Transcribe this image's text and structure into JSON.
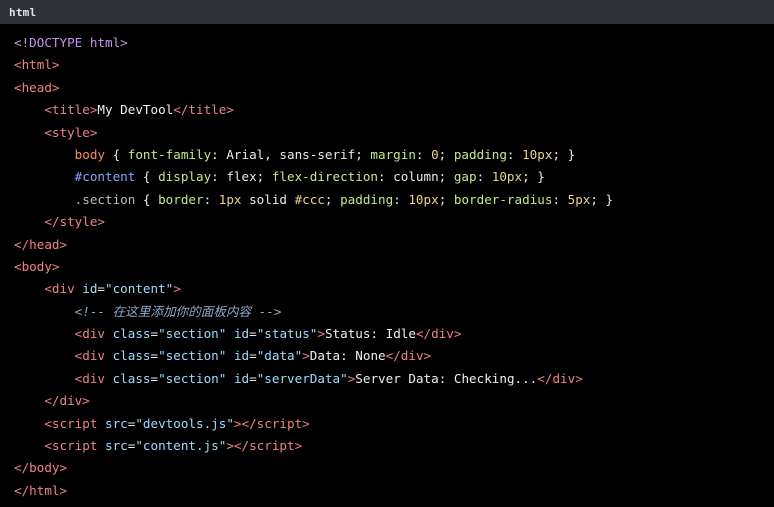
{
  "header": {
    "language": "html"
  },
  "colors": {
    "background": "#000000",
    "header_bg": "#2f3139",
    "tag": "#ee8383",
    "attr": "#9cdcfe",
    "text": "#f0f0f0",
    "doctype": "#c792ea",
    "comment": "#8faac5"
  },
  "code_lines": [
    [
      {
        "t": "<!DOCTYPE ",
        "c": "tok-doctype"
      },
      {
        "t": "html",
        "c": "tok-doctype"
      },
      {
        "t": ">",
        "c": "tok-doctype"
      }
    ],
    [
      {
        "t": "<html>",
        "c": "tok-tag"
      }
    ],
    [
      {
        "t": "<head>",
        "c": "tok-tag"
      }
    ],
    [
      {
        "t": "    <title>",
        "c": "tok-tag"
      },
      {
        "t": "My DevTool",
        "c": "tok-text"
      },
      {
        "t": "</title>",
        "c": "tok-tag"
      }
    ],
    [
      {
        "t": "    <style>",
        "c": "tok-tag"
      }
    ],
    [
      {
        "t": "        body",
        "c": "tok-sel"
      },
      {
        "t": " { ",
        "c": "tok-punc"
      },
      {
        "t": "font-family",
        "c": "tok-prop"
      },
      {
        "t": ": ",
        "c": "tok-punc"
      },
      {
        "t": "Arial, sans-serif",
        "c": "tok-punc"
      },
      {
        "t": "; ",
        "c": "tok-punc"
      },
      {
        "t": "margin",
        "c": "tok-prop"
      },
      {
        "t": ": ",
        "c": "tok-punc"
      },
      {
        "t": "0",
        "c": "tok-val"
      },
      {
        "t": "; ",
        "c": "tok-punc"
      },
      {
        "t": "padding",
        "c": "tok-prop"
      },
      {
        "t": ": ",
        "c": "tok-punc"
      },
      {
        "t": "10px",
        "c": "tok-val"
      },
      {
        "t": "; }",
        "c": "tok-punc"
      }
    ],
    [
      {
        "t": "        #content",
        "c": "tok-selid"
      },
      {
        "t": " { ",
        "c": "tok-punc"
      },
      {
        "t": "display",
        "c": "tok-prop"
      },
      {
        "t": ": ",
        "c": "tok-punc"
      },
      {
        "t": "flex",
        "c": "tok-punc"
      },
      {
        "t": "; ",
        "c": "tok-punc"
      },
      {
        "t": "flex-direction",
        "c": "tok-prop"
      },
      {
        "t": ": ",
        "c": "tok-punc"
      },
      {
        "t": "column",
        "c": "tok-punc"
      },
      {
        "t": "; ",
        "c": "tok-punc"
      },
      {
        "t": "gap",
        "c": "tok-prop"
      },
      {
        "t": ": ",
        "c": "tok-punc"
      },
      {
        "t": "10px",
        "c": "tok-val"
      },
      {
        "t": "; }",
        "c": "tok-punc"
      }
    ],
    [
      {
        "t": "        .section",
        "c": "tok-selclass"
      },
      {
        "t": " { ",
        "c": "tok-punc"
      },
      {
        "t": "border",
        "c": "tok-prop"
      },
      {
        "t": ": ",
        "c": "tok-punc"
      },
      {
        "t": "1px",
        "c": "tok-val"
      },
      {
        "t": " solid ",
        "c": "tok-punc"
      },
      {
        "t": "#ccc",
        "c": "tok-val"
      },
      {
        "t": "; ",
        "c": "tok-punc"
      },
      {
        "t": "padding",
        "c": "tok-prop"
      },
      {
        "t": ": ",
        "c": "tok-punc"
      },
      {
        "t": "10px",
        "c": "tok-val"
      },
      {
        "t": "; ",
        "c": "tok-punc"
      },
      {
        "t": "border-radius",
        "c": "tok-prop"
      },
      {
        "t": ": ",
        "c": "tok-punc"
      },
      {
        "t": "5px",
        "c": "tok-val"
      },
      {
        "t": "; }",
        "c": "tok-punc"
      }
    ],
    [
      {
        "t": "    </style>",
        "c": "tok-tag"
      }
    ],
    [
      {
        "t": "</head>",
        "c": "tok-tag"
      }
    ],
    [
      {
        "t": "<body>",
        "c": "tok-tag"
      }
    ],
    [
      {
        "t": "    <div ",
        "c": "tok-tag"
      },
      {
        "t": "id",
        "c": "tok-attr"
      },
      {
        "t": "=",
        "c": "tok-punc"
      },
      {
        "t": "\"content\"",
        "c": "tok-str"
      },
      {
        "t": ">",
        "c": "tok-tag"
      }
    ],
    [
      {
        "t": "        <!-- 在这里添加你的面板内容 -->",
        "c": "tok-comment"
      }
    ],
    [
      {
        "t": "        <div ",
        "c": "tok-tag"
      },
      {
        "t": "class",
        "c": "tok-attr"
      },
      {
        "t": "=",
        "c": "tok-punc"
      },
      {
        "t": "\"section\"",
        "c": "tok-str"
      },
      {
        "t": " ",
        "c": "tok-punc"
      },
      {
        "t": "id",
        "c": "tok-attr"
      },
      {
        "t": "=",
        "c": "tok-punc"
      },
      {
        "t": "\"status\"",
        "c": "tok-str"
      },
      {
        "t": ">",
        "c": "tok-tag"
      },
      {
        "t": "Status: Idle",
        "c": "tok-text"
      },
      {
        "t": "</div>",
        "c": "tok-tag"
      }
    ],
    [
      {
        "t": "        <div ",
        "c": "tok-tag"
      },
      {
        "t": "class",
        "c": "tok-attr"
      },
      {
        "t": "=",
        "c": "tok-punc"
      },
      {
        "t": "\"section\"",
        "c": "tok-str"
      },
      {
        "t": " ",
        "c": "tok-punc"
      },
      {
        "t": "id",
        "c": "tok-attr"
      },
      {
        "t": "=",
        "c": "tok-punc"
      },
      {
        "t": "\"data\"",
        "c": "tok-str"
      },
      {
        "t": ">",
        "c": "tok-tag"
      },
      {
        "t": "Data: None",
        "c": "tok-text"
      },
      {
        "t": "</div>",
        "c": "tok-tag"
      }
    ],
    [
      {
        "t": "        <div ",
        "c": "tok-tag"
      },
      {
        "t": "class",
        "c": "tok-attr"
      },
      {
        "t": "=",
        "c": "tok-punc"
      },
      {
        "t": "\"section\"",
        "c": "tok-str"
      },
      {
        "t": " ",
        "c": "tok-punc"
      },
      {
        "t": "id",
        "c": "tok-attr"
      },
      {
        "t": "=",
        "c": "tok-punc"
      },
      {
        "t": "\"serverData\"",
        "c": "tok-str"
      },
      {
        "t": ">",
        "c": "tok-tag"
      },
      {
        "t": "Server Data: Checking...",
        "c": "tok-text"
      },
      {
        "t": "</div>",
        "c": "tok-tag"
      }
    ],
    [
      {
        "t": "    </div>",
        "c": "tok-tag"
      }
    ],
    [
      {
        "t": "    <script ",
        "c": "tok-tag"
      },
      {
        "t": "src",
        "c": "tok-attr"
      },
      {
        "t": "=",
        "c": "tok-punc"
      },
      {
        "t": "\"devtools.js\"",
        "c": "tok-str"
      },
      {
        "t": "></",
        "c": "tok-tag"
      },
      {
        "t": "script>",
        "c": "tok-tag"
      }
    ],
    [
      {
        "t": "    <script ",
        "c": "tok-tag"
      },
      {
        "t": "src",
        "c": "tok-attr"
      },
      {
        "t": "=",
        "c": "tok-punc"
      },
      {
        "t": "\"content.js\"",
        "c": "tok-str"
      },
      {
        "t": "></",
        "c": "tok-tag"
      },
      {
        "t": "script>",
        "c": "tok-tag"
      }
    ],
    [
      {
        "t": "</body>",
        "c": "tok-tag"
      }
    ],
    [
      {
        "t": "</html>",
        "c": "tok-tag"
      }
    ]
  ]
}
